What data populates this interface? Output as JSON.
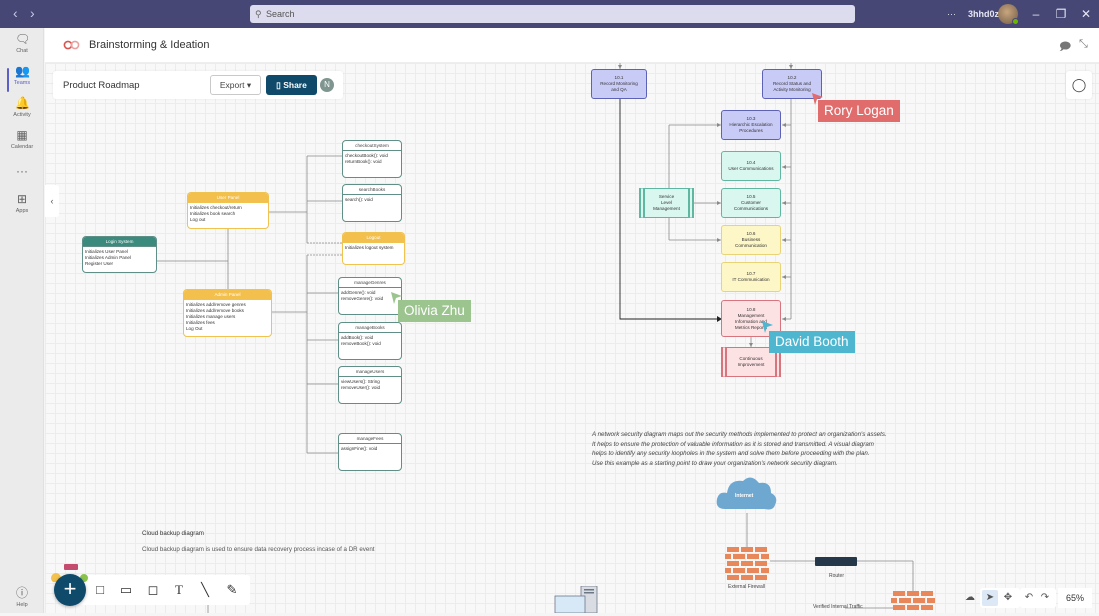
{
  "titlebar": {
    "search_placeholder": "Search",
    "more_label": "···",
    "tenant": "3hhd0z",
    "minimize": "–",
    "maximize": "❐",
    "close": "✕"
  },
  "rail": {
    "items": [
      {
        "label": "Chat",
        "icon": "chat-icon"
      },
      {
        "label": "Teams",
        "icon": "teams-icon"
      },
      {
        "label": "Activity",
        "icon": "bell-icon"
      },
      {
        "label": "Calendar",
        "icon": "calendar-icon"
      },
      {
        "label": "···",
        "icon": "more-icon"
      },
      {
        "label": "Apps",
        "icon": "apps-icon"
      }
    ],
    "help": "Help"
  },
  "app": {
    "title": "Brainstorming & Ideation"
  },
  "docbar": {
    "name": "Product Roadmap",
    "export": "Export ▾",
    "share": "Share",
    "user_initial": "N"
  },
  "uml": {
    "login": {
      "title": "Login System",
      "lines": [
        "Initializes User Panel",
        "Initializes Admin Panel",
        "Register User"
      ]
    },
    "user_panel": {
      "title": "User Panel",
      "lines": [
        "Initializes checkout/return",
        "Initializes book search",
        "Log out"
      ]
    },
    "admin_panel": {
      "title": "Admin Panel",
      "lines": [
        "Initializes add/remove genres",
        "Initializes add/remove books",
        "Initializes manage users",
        "Initializes fees",
        "Log Out"
      ]
    },
    "checkout": {
      "title": "checkoutSystem",
      "lines": [
        "checkoutBook(): void",
        "returnBook(): void"
      ]
    },
    "search": {
      "title": "searchBooks",
      "lines": [
        "search(): void"
      ]
    },
    "logout": {
      "title": "Logout",
      "lines": [
        "Initializes logout system"
      ]
    },
    "genres": {
      "title": "manageGenres",
      "lines": [
        "addGenre(): void",
        "removeGenre(): void"
      ]
    },
    "books": {
      "title": "manageBooks",
      "lines": [
        "addBook(): void",
        "removeBook(): void"
      ]
    },
    "users": {
      "title": "manageUsers",
      "lines": [
        "viewUsers(): String",
        "removeUser(): void"
      ]
    },
    "fees": {
      "title": "manageFees",
      "lines": [
        "assignFine(): void"
      ]
    }
  },
  "flow": {
    "b101": [
      "10.1",
      "Record Monitoring",
      "and QA"
    ],
    "b102": [
      "10.2",
      "Record Status and",
      "Activity Monitoring"
    ],
    "b103": [
      "10.3",
      "Hierarchic Escalation",
      "Procedures"
    ],
    "b104": [
      "10.4",
      "User Communications"
    ],
    "b105": [
      "10.5",
      "Customer",
      "Communications"
    ],
    "b106": [
      "10.6",
      "Business",
      "Communication"
    ],
    "b107": [
      "10.7",
      "IT Communication"
    ],
    "b108": [
      "10.8",
      "Management",
      "Information and",
      "Metrics Reports"
    ],
    "slm": [
      "Service",
      "Level",
      "Management"
    ],
    "ci": [
      "Continuous",
      "Improvement"
    ]
  },
  "cursors": {
    "rory": {
      "name": "Rory Logan",
      "color": "#e06c6c"
    },
    "olivia": {
      "name": "Olivia Zhu",
      "color": "#9cc48f"
    },
    "david": {
      "name": "David Booth",
      "color": "#4fb6d0"
    }
  },
  "network_note": [
    "A network security diagram maps out the security methods implemented to protect an organization's assets.",
    "It helps to ensure the protection of valuable information as it is stored and transmitted. A visual diagram",
    "helps to identify any security loopholes in the system and solve them before proceeding with the plan.",
    "Use this example as a starting point to draw your organization's network security diagram."
  ],
  "network": {
    "internet": "Internet",
    "firewall": "External Firewall",
    "router": "Router",
    "verified": "Verified Internal Traffic"
  },
  "cloud_backup": {
    "title": "Cloud backup diagram",
    "desc": "Cloud backup diagram is used to ensure data recovery process incase of a DR event"
  },
  "toolbar": {
    "add": "+",
    "tools": [
      "rectangle-tool",
      "card-tool",
      "sticky-note-tool",
      "text-tool",
      "line-tool",
      "pen-tool"
    ]
  },
  "bottom_right": {
    "zoom": "65%"
  }
}
